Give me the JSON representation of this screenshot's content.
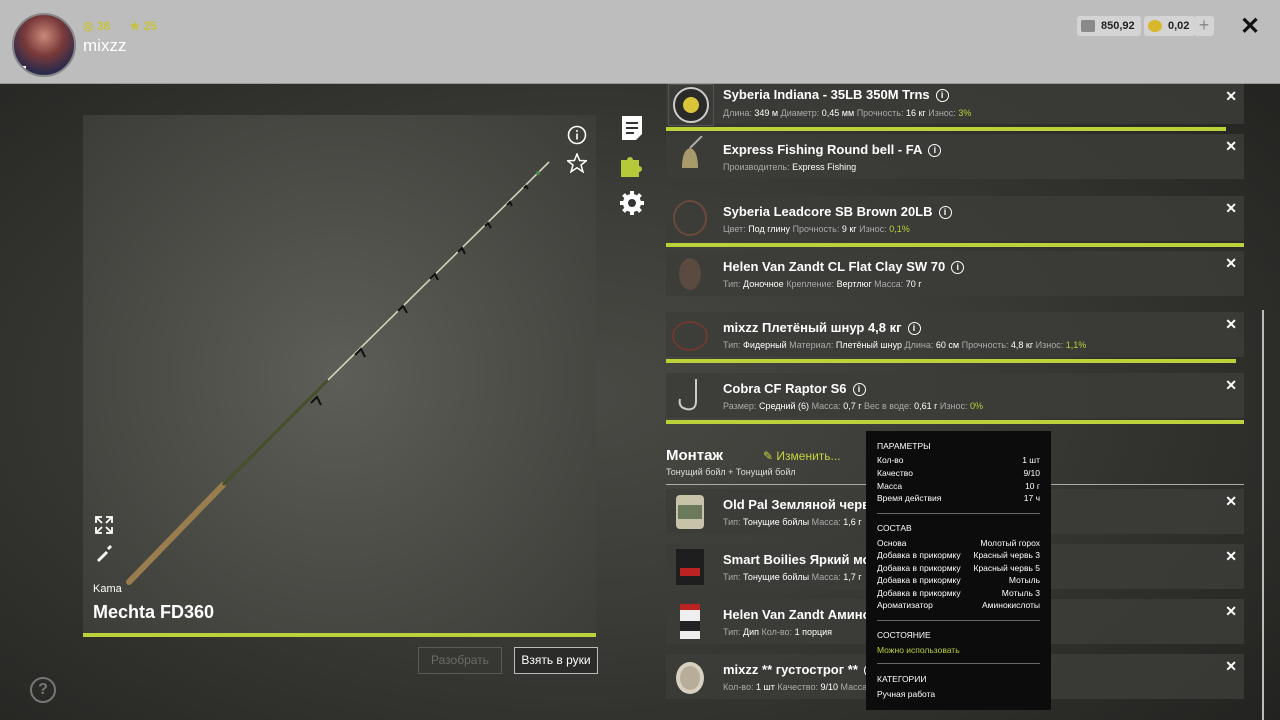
{
  "header": {
    "level": "38",
    "rating": "25",
    "username": "mixzz",
    "money": "850,92",
    "gold": "0,02",
    "plus_label": "+",
    "close_label": "✕"
  },
  "rod": {
    "brand": "Kama",
    "name": "Mechta FD360",
    "disassemble_label": "Разобрать",
    "take_label": "Взять в руки"
  },
  "items": [
    {
      "title": "Syberia Indiana - 35LB 350M Trns",
      "props": [
        [
          "Длина:",
          "349 м"
        ],
        [
          "Диаметр:",
          "0,45 мм"
        ],
        [
          "Прочность:",
          "16 кг"
        ],
        [
          "Износ:",
          "3%"
        ]
      ]
    },
    {
      "title": "Express Fishing Round bell - FA",
      "props": [
        [
          "Производитель:",
          "Express Fishing"
        ]
      ]
    },
    {
      "title": "Syberia Leadcore SB Brown 20LB",
      "props": [
        [
          "Цвет:",
          "Под глину"
        ],
        [
          "Прочность:",
          "9 кг"
        ],
        [
          "Износ:",
          "0,1%"
        ]
      ]
    },
    {
      "title": "Helen Van Zandt CL Flat Clay SW 70",
      "props": [
        [
          "Тип:",
          "Доночное"
        ],
        [
          "Крепление:",
          "Вертлюг"
        ],
        [
          "Масса:",
          "70 г"
        ]
      ]
    },
    {
      "title": "mixzz Плетёный шнур 4,8 кг",
      "props": [
        [
          "Тип:",
          "Фидерный"
        ],
        [
          "Материал:",
          "Плетёный шнур"
        ],
        [
          "Длина:",
          "60 см"
        ],
        [
          "Прочность:",
          "4,8 кг"
        ],
        [
          "Износ:",
          "1,1%"
        ]
      ]
    },
    {
      "title": "Cobra CF Raptor S6",
      "props": [
        [
          "Размер:",
          "Средний (6)"
        ],
        [
          "Масса:",
          "0,7 г"
        ],
        [
          "Вес в воде:",
          "0,61 г"
        ],
        [
          "Износ:",
          "0%"
        ]
      ]
    }
  ],
  "montage": {
    "title": "Монтаж",
    "edit_label": "Изменить...",
    "subtitle": "Тонущий бойл  +  Тонущий бойл"
  },
  "baits": [
    {
      "title": "Old Pal Земляной червь",
      "props": [
        [
          "Тип:",
          "Тонущие бойлы"
        ],
        [
          "Масса:",
          "1,6 г"
        ]
      ]
    },
    {
      "title": "Smart Boilies Яркий мотыль",
      "props": [
        [
          "Тип:",
          "Тонущие бойлы"
        ],
        [
          "Масса:",
          "1,7 г"
        ]
      ]
    },
    {
      "title": "Helen Van Zandt Амино I",
      "props": [
        [
          "Тип:",
          "Дип"
        ],
        [
          "Кол-во:",
          "1 порция"
        ]
      ]
    },
    {
      "title": "mixzz ** густострог **",
      "props": [
        [
          "Кол-во:",
          "1 шт"
        ],
        [
          "Качество:",
          "9/10"
        ],
        [
          "Масса:",
          ""
        ]
      ]
    }
  ],
  "tooltip": {
    "params_header": "ПАРАМЕТРЫ",
    "params": [
      [
        "Кол-во",
        "1 шт"
      ],
      [
        "Качество",
        "9/10"
      ],
      [
        "Масса",
        "10 г"
      ],
      [
        "Время действия",
        "17 ч"
      ]
    ],
    "composition_header": "СОСТАВ",
    "composition": [
      [
        "Основа",
        "Молотый горох"
      ],
      [
        "Добавка в прикормку",
        "Красный червь 3"
      ],
      [
        "Добавка в прикормку",
        "Красный червь 5"
      ],
      [
        "Добавка в прикормку",
        "Мотыль"
      ],
      [
        "Добавка в прикормку",
        "Мотыль 3"
      ],
      [
        "Ароматизатор",
        "Аминокислоты"
      ]
    ],
    "state_header": "СОСТОЯНИЕ",
    "state": "Можно использовать",
    "categories_header": "КАТЕГОРИИ",
    "category": "Ручная работа"
  },
  "colors": {
    "accent": "#bcd13a",
    "topbar": "#bdbdbd"
  }
}
